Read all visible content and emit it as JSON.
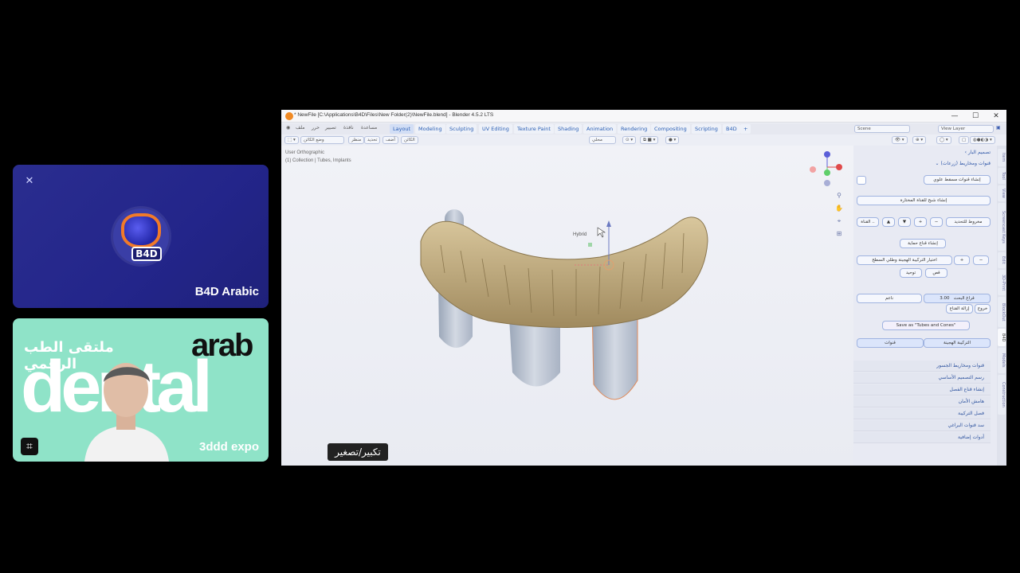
{
  "left_tiles": {
    "host": {
      "name": "B4D Arabic",
      "badge": "B4D",
      "mic_icon": "mic-off-icon"
    },
    "expo": {
      "label": "3ddd expo",
      "arabic_title": "ملتقى الطب الرقمي",
      "brand_word": "arab",
      "big_word": "dental"
    }
  },
  "blender": {
    "title": "* NewFile [C:\\Applications\\B4D\\Files\\New Folder(2)\\NewFile.blend] - Blender 4.5.2 LTS",
    "window_buttons": [
      "—",
      "☐",
      "✕"
    ],
    "menus": [
      "ملف",
      "حرر",
      "تصيير",
      "نافذة",
      "مساعدة"
    ],
    "workspaces": [
      "Layout",
      "Modeling",
      "Sculpting",
      "UV Editing",
      "Texture Paint",
      "Shading",
      "Animation",
      "Rendering",
      "Compositing",
      "Scripting",
      "B4D",
      "+"
    ],
    "active_workspace": "Layout",
    "scene": "Scene",
    "view_layer": "View Layer",
    "toolbar": {
      "mode": "وضع الكائن",
      "view": "منظر",
      "select": "تحديد",
      "add": "أضف",
      "object": "الكائن",
      "orientation": "محلي"
    },
    "viewport": {
      "info_line1": "User Orthographic",
      "info_line2": "(1) Collection | Tubes, Implants",
      "hybrid_label": "Hybrid",
      "tooltip": "تكبير/تصغير"
    },
    "panel": {
      "header_top": "تصميم البار",
      "header_sub": "قنوات ومخاريط (زرعات)",
      "btn_create_channels": "إنشاء قنوات مسقط علوي",
      "btn_create_mesh": "إنشاء شبح للقناة المختارة",
      "btn_cones_for_select": "مخروط للتحديد",
      "btn_channel": "القناة ..",
      "btn_protective_mask": "إنشاء قناع حماية",
      "btn_hybrid_select": "اختيار التركيبة الهجينة وطلي السطح",
      "btn_cut": "قص",
      "btn_unify": "توحيد",
      "smooth_label": "ناعم",
      "offset_label": "قراغ البحث",
      "offset_value": "3.00",
      "btn_exit": "خروج",
      "btn_remove_mask": "إزالة القناع",
      "btn_save_as": "Save as \"Tubes and Cones\"",
      "toggle_hybrid": "التركيبة الهجينة",
      "toggle_channels": "قنوات",
      "sections": [
        "قنوات ومخاريط الجسور",
        "رسم التصميم الأساسي",
        "إنشاء قناع الفصل",
        "هامش الأمان",
        "فصل التركيبة",
        "سد قنوات البراغي",
        "أدوات إضافية"
      ]
    },
    "side_tabs": [
      "Item",
      "Tool",
      "View",
      "Screencast Keys",
      "Edit",
      "3D-Print",
      "BlockOut",
      "B4D",
      "Models",
      "Construction"
    ],
    "active_side_tab": "B4D"
  },
  "colors": {
    "accent": "#2b5fb5",
    "host_bg": "#23258a",
    "expo_bg": "#8fe3c8",
    "tooth": "#c9b48a",
    "gum_cyl": "#bfc7d6"
  }
}
